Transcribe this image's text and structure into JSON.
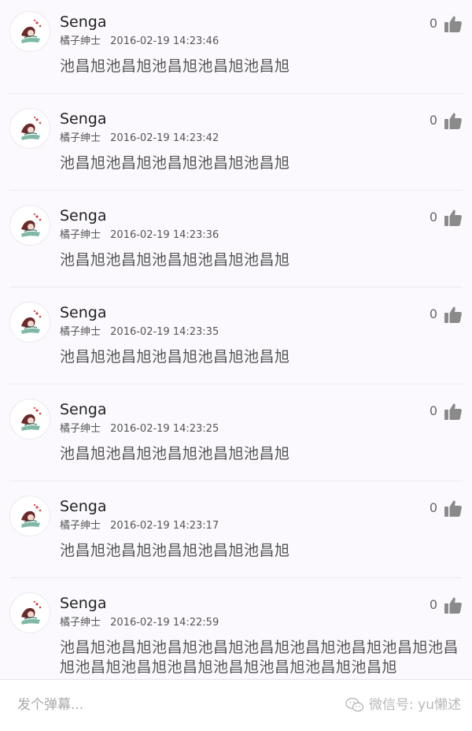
{
  "comments": [
    {
      "name": "Senga",
      "user": "橘子绅士",
      "time": "2016-02-19 14:23:46",
      "text": "池昌旭池昌旭池昌旭池昌旭池昌旭",
      "likes": "0"
    },
    {
      "name": "Senga",
      "user": "橘子绅士",
      "time": "2016-02-19 14:23:42",
      "text": "池昌旭池昌旭池昌旭池昌旭池昌旭",
      "likes": "0"
    },
    {
      "name": "Senga",
      "user": "橘子绅士",
      "time": "2016-02-19 14:23:36",
      "text": "池昌旭池昌旭池昌旭池昌旭池昌旭",
      "likes": "0"
    },
    {
      "name": "Senga",
      "user": "橘子绅士",
      "time": "2016-02-19 14:23:35",
      "text": "池昌旭池昌旭池昌旭池昌旭池昌旭",
      "likes": "0"
    },
    {
      "name": "Senga",
      "user": "橘子绅士",
      "time": "2016-02-19 14:23:25",
      "text": "池昌旭池昌旭池昌旭池昌旭池昌旭",
      "likes": "0"
    },
    {
      "name": "Senga",
      "user": "橘子绅士",
      "time": "2016-02-19 14:23:17",
      "text": "池昌旭池昌旭池昌旭池昌旭池昌旭",
      "likes": "0"
    },
    {
      "name": "Senga",
      "user": "橘子绅士",
      "time": "2016-02-19 14:22:59",
      "text": "池昌旭池昌旭池昌旭池昌旭池昌旭池昌旭池昌旭池昌旭池昌旭池昌旭池昌旭池昌旭池昌旭池昌旭池昌旭池昌旭",
      "likes": "0"
    }
  ],
  "input_bar": {
    "placeholder": "发个弹幕...",
    "watermark": "微信号: yu懒述"
  },
  "icons": {
    "like": "thumbs-up-icon",
    "watermark": "wechat-icon",
    "avatar": "anime-girl-avatar"
  },
  "colors": {
    "background": "#fbf9fd",
    "name_text": "#222222",
    "secondary_text": "#555555",
    "icon": "#8a8a8a"
  }
}
